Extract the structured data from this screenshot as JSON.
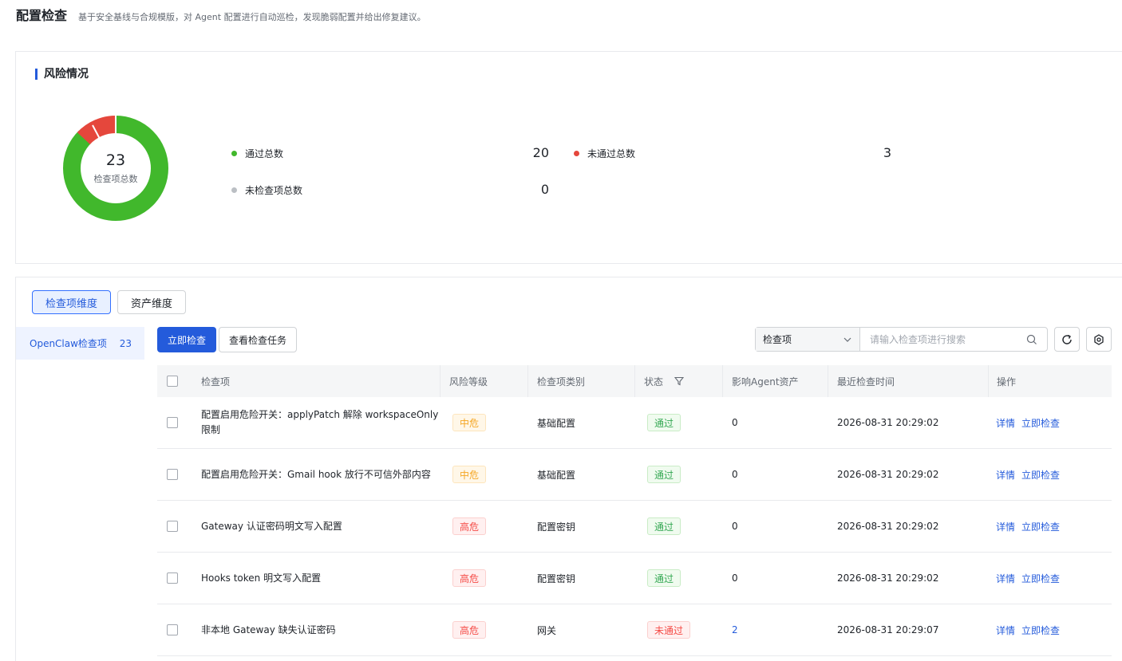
{
  "header": {
    "title": "配置检查",
    "description": "基于安全基线与合规模版，对 Agent 配置进行自动巡检，发现脆弱配置并给出修复建议。"
  },
  "risk": {
    "title": "风险情况",
    "total": "23",
    "total_label": "检查项总数",
    "passed_label": "通过总数",
    "passed_value": "20",
    "failed_label": "未通过总数",
    "failed_value": "3",
    "unchecked_label": "未检查项总数",
    "unchecked_value": "0",
    "colors": {
      "passed": "#41b82c",
      "failed": "#e5473c",
      "unchecked": "#bbbfc4"
    }
  },
  "view_tabs": {
    "check_item": "检查项维度",
    "asset": "资产维度"
  },
  "sidebar": {
    "item_label": "OpenClaw检查项",
    "item_count": "23"
  },
  "toolbar": {
    "check_now": "立即检查",
    "view_tasks": "查看检查任务",
    "search_select": "检查项",
    "search_placeholder": "请输入检查项进行搜索"
  },
  "table": {
    "headers": {
      "name": "检查项",
      "level": "风险等级",
      "category": "检查项类别",
      "status": "状态",
      "assets": "影响Agent资产",
      "time": "最近检查时间",
      "ops": "操作"
    },
    "op_detail": "详情",
    "op_check": "立即检查",
    "rows": [
      {
        "name": "配置启用危险开关：applyPatch 解除 workspaceOnly 限制",
        "level": "中危",
        "level_type": "mid",
        "category": "基础配置",
        "status": "通过",
        "status_type": "pass",
        "assets": "0",
        "time": "2026-08-31 20:29:02"
      },
      {
        "name": "配置启用危险开关：Gmail hook 放行不可信外部内容",
        "level": "中危",
        "level_type": "mid",
        "category": "基础配置",
        "status": "通过",
        "status_type": "pass",
        "assets": "0",
        "time": "2026-08-31 20:29:02"
      },
      {
        "name": "Gateway 认证密码明文写入配置",
        "level": "高危",
        "level_type": "high",
        "category": "配置密钥",
        "status": "通过",
        "status_type": "pass",
        "assets": "0",
        "time": "2026-08-31 20:29:02"
      },
      {
        "name": "Hooks token 明文写入配置",
        "level": "高危",
        "level_type": "high",
        "category": "配置密钥",
        "status": "通过",
        "status_type": "pass",
        "assets": "0",
        "time": "2026-08-31 20:29:02"
      },
      {
        "name": "非本地 Gateway 缺失认证密码",
        "level": "高危",
        "level_type": "high",
        "category": "网关",
        "status": "未通过",
        "status_type": "fail",
        "assets": "2",
        "time": "2026-08-31 20:29:07"
      }
    ]
  }
}
